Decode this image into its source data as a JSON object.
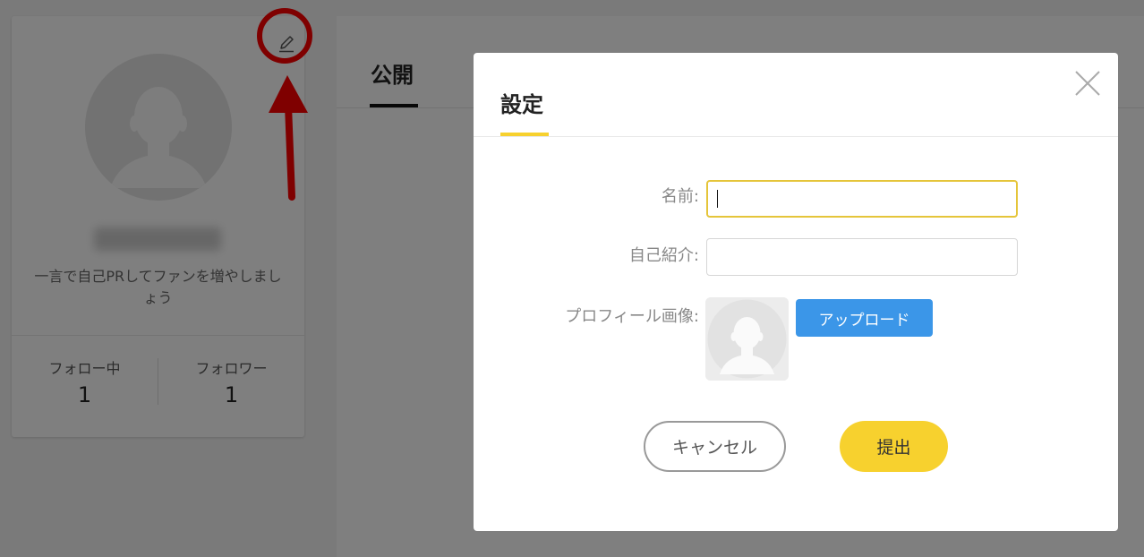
{
  "profile": {
    "username": "xbr1q4kes",
    "bio_prompt": "一言で自己PRしてファンを増やしましょう",
    "following_label": "フォロー中",
    "following_count": "1",
    "followers_label": "フォロワー",
    "followers_count": "1"
  },
  "content": {
    "tab_public": "公開"
  },
  "modal": {
    "title": "設定",
    "name_label": "名前:",
    "name_value": "",
    "bio_label": "自己紹介:",
    "bio_value": "",
    "image_label": "プロフィール画像:",
    "upload_label": "アップロード",
    "cancel_label": "キャンセル",
    "submit_label": "提出"
  },
  "colors": {
    "accent_yellow": "#f7d12e",
    "upload_blue": "#3b96e8",
    "annotation_red": "#ff0000"
  },
  "icons": [
    "edit-pencil-icon",
    "close-icon",
    "avatar-placeholder-icon"
  ]
}
